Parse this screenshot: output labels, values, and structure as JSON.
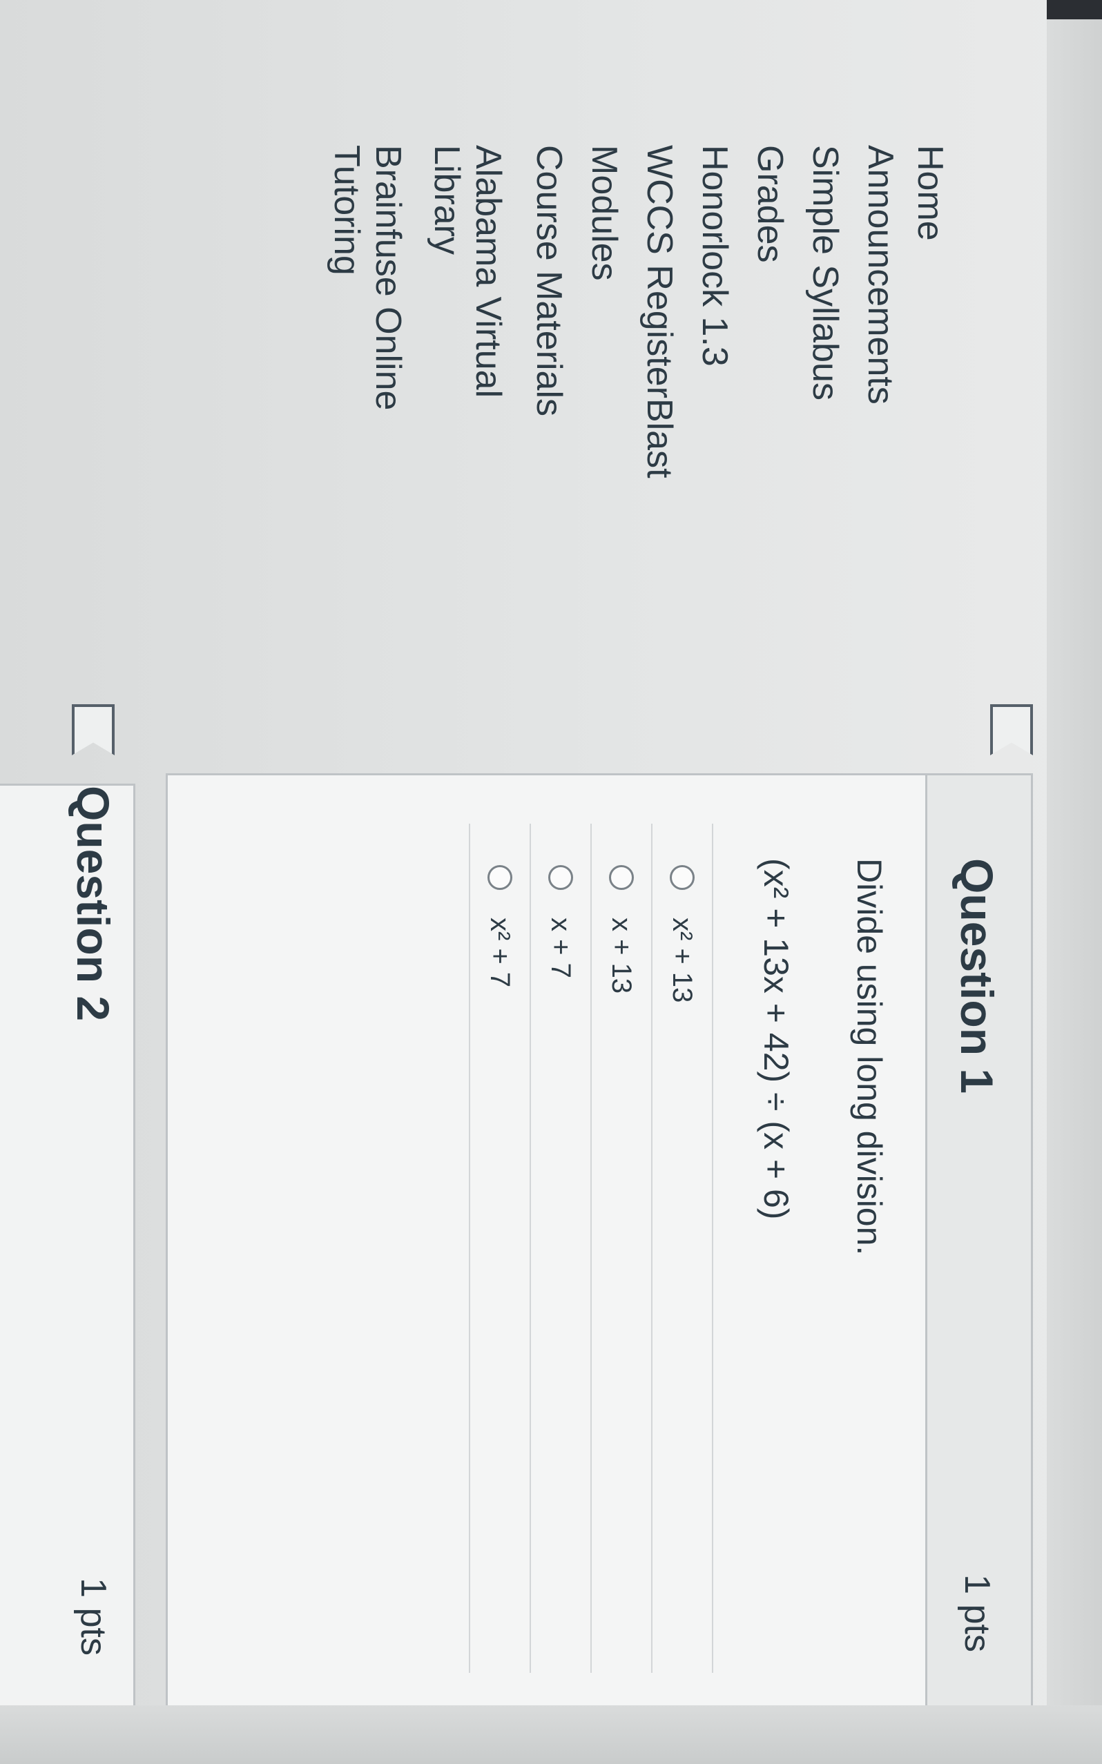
{
  "sidebar": {
    "items": [
      {
        "label": "Home"
      },
      {
        "label": "Announcements"
      },
      {
        "label": "Simple Syllabus"
      },
      {
        "label": "Grades"
      },
      {
        "label": "Honorlock 1.3"
      },
      {
        "label": "WCCS RegisterBlast"
      },
      {
        "label": "Modules"
      },
      {
        "label": "Course Materials"
      },
      {
        "label": "Alabama Virtual",
        "label2": "Library"
      },
      {
        "label": "Brainfuse Online",
        "label2": "Tutoring"
      }
    ]
  },
  "question1": {
    "title": "Question 1",
    "points": "1 pts",
    "prompt": "Divide using long division.",
    "expression": "(x² + 13x + 42) ÷ (x + 6)",
    "answers": [
      {
        "label": "x² + 13"
      },
      {
        "label": "x + 13"
      },
      {
        "label": "x + 7"
      },
      {
        "label": "x² + 7"
      }
    ]
  },
  "question2": {
    "title": "Question 2",
    "points": "1 pts"
  }
}
